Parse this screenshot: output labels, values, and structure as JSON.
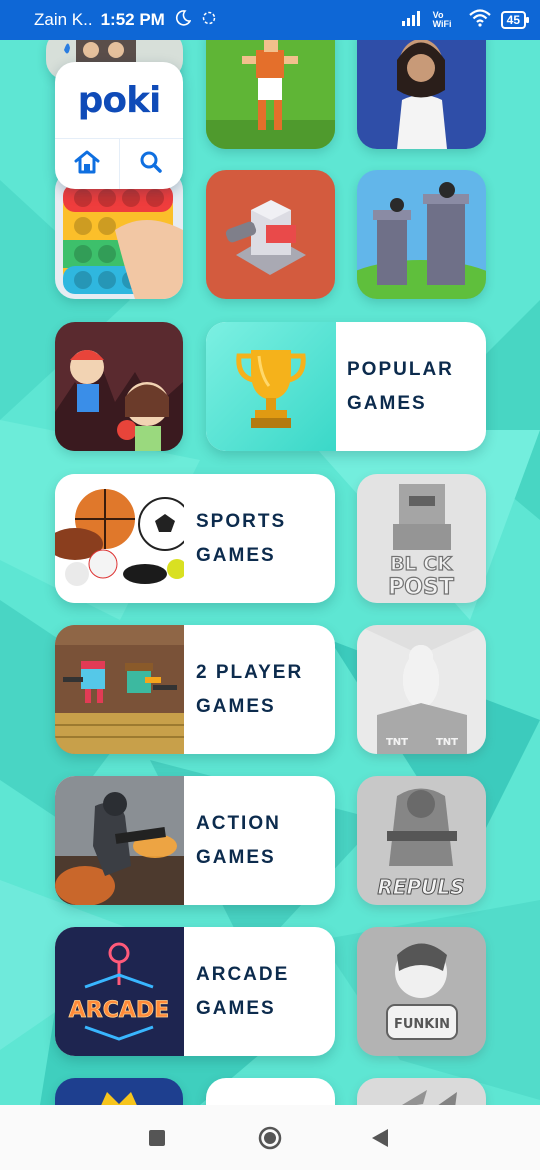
{
  "status_bar": {
    "carrier": "Zain K..",
    "time": "1:52 PM",
    "network": "Vo WiFi",
    "battery": "45"
  },
  "logo": {
    "text": "poki",
    "home_icon": "home-icon",
    "search_icon": "search-icon"
  },
  "categories": {
    "popular": {
      "line1": "POPULAR",
      "line2": "GAMES"
    },
    "sports": {
      "line1": "SPORTS",
      "line2": "GAMES"
    },
    "two_player": {
      "line1": "2 PLAYER",
      "line2": "GAMES"
    },
    "action": {
      "line1": "ACTION",
      "line2": "GAMES"
    },
    "arcade": {
      "line1": "ARCADE",
      "line2": "GAMES"
    }
  },
  "thumb_text": {
    "blockpost_line1": "BL CK",
    "blockpost_line2": "POST",
    "tnt_left": "TNT",
    "tnt_right": "TNT",
    "repuls": "REPULS",
    "fnf": "FUNKIN",
    "arcade": "ARCADE"
  },
  "colors": {
    "status_bar": "#0e67d6",
    "background": "#5ee6d3",
    "category_text": "#0c2b4d",
    "logo_blue": "#0f4bb8"
  },
  "nav": {
    "recents": "square-icon",
    "home": "circle-home-icon",
    "back": "triangle-back-icon"
  }
}
